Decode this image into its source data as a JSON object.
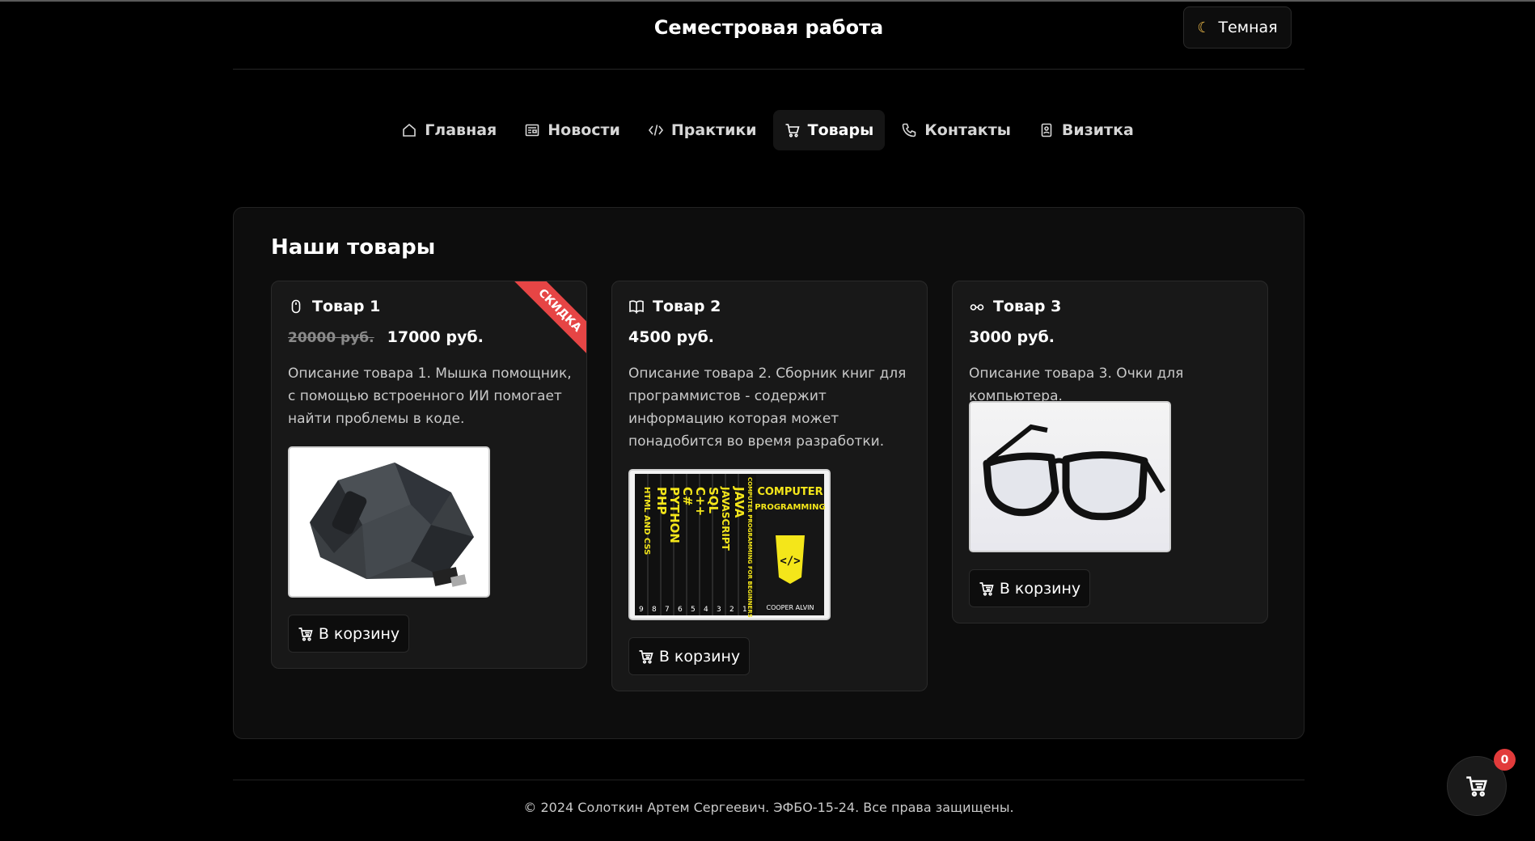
{
  "header": {
    "title": "Семестровая работа",
    "theme_label": "Темная"
  },
  "nav": {
    "items": [
      {
        "label": "Главная",
        "icon": "home-icon"
      },
      {
        "label": "Новости",
        "icon": "newspaper-icon"
      },
      {
        "label": "Практики",
        "icon": "code-icon"
      },
      {
        "label": "Товары",
        "icon": "cart-icon",
        "active": true
      },
      {
        "label": "Контакты",
        "icon": "phone-icon"
      },
      {
        "label": "Визитка",
        "icon": "badge-icon"
      }
    ]
  },
  "products": {
    "title": "Наши товары",
    "items": [
      {
        "name": "Товар 1",
        "icon": "mouse-icon",
        "old_price": "20000 руб.",
        "price": "17000 руб.",
        "badge": "СКИДКА",
        "description": "Описание товара 1. Мышка помощник, с помощью встроенного ИИ помогает найти проблемы в коде.",
        "button": "В корзину"
      },
      {
        "name": "Товар 2",
        "icon": "book-icon",
        "price": "4500 руб.",
        "description": "Описание товара 2. Сборник книг для программистов - содержит информацию которая может понадобится во время разработки.",
        "button": "В корзину",
        "image_text": {
          "cover_title": "COMPUTER PROGRAMMING",
          "author": "COOPER ALVIN",
          "spines": [
            "HTML AND CSS",
            "PHP",
            "PYTHON",
            "C#",
            "C++",
            "SQL",
            "JAVASCRIPT",
            "JAVA",
            "COMPUTER PROGRAMMING FOR BEGINNERS"
          ],
          "numbers": [
            "9",
            "8",
            "7",
            "6",
            "5",
            "4",
            "3",
            "2",
            "1"
          ]
        }
      },
      {
        "name": "Товар 3",
        "icon": "glasses-icon",
        "price": "3000 руб.",
        "description": "Описание товара 3. Очки для компьютера.",
        "button": "В корзину"
      }
    ]
  },
  "footer": {
    "text": "© 2024 Солоткин Артем Сергеевич. ЭФБО-15-24. Все права защищены."
  },
  "cart": {
    "count": "0"
  },
  "colors": {
    "background": "#000000",
    "card": "#181818",
    "badge": "#e64545",
    "book_accent": "#f4e61a"
  }
}
